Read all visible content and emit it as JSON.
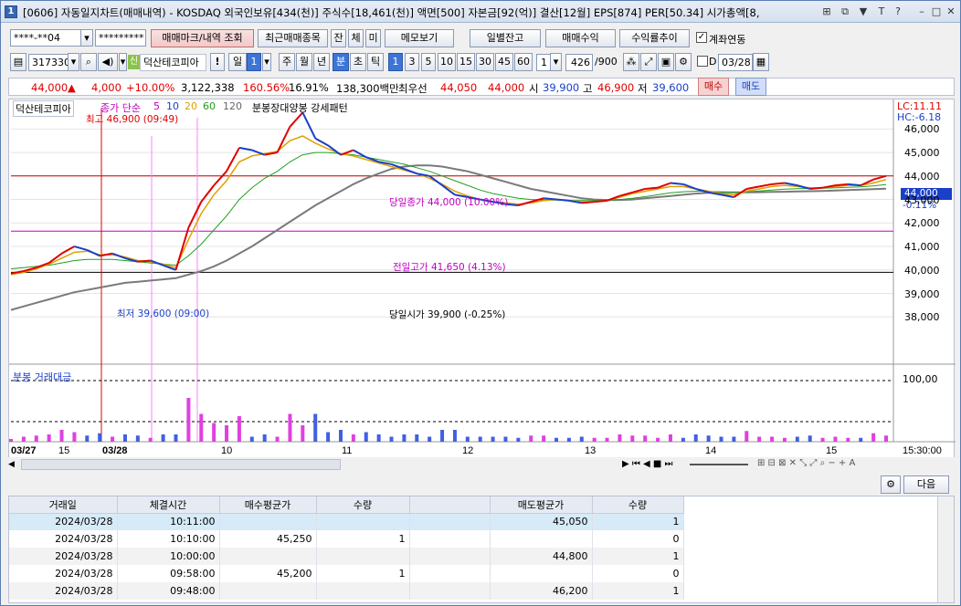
{
  "title": "[0606] 자동일지차트(매매내역) - KOSDAQ 외국인보유[434(천)] 주식수[18,461(천)] 액면[500] 자본금[92(억)] 결산[12월] EPS[874] PER[50.34] 시가총액[8,",
  "window_num": "1",
  "toolbar1": {
    "account": "****-**04",
    "password": "*********",
    "trade_mark_btn": "매매마크/내역 조회",
    "recent_trades_btn": "최근매매종목",
    "btn_balance": "잔",
    "btn_exec": "체",
    "btn_unexec": "미",
    "memo_btn": "메모보기",
    "daily_balance_btn": "일별잔고",
    "trade_profit_btn": "매매수익",
    "profit_trend_btn": "수익률추이",
    "account_link_label": "계좌연동"
  },
  "toolbar2": {
    "code": "317330",
    "credit_badge": "신",
    "stock_name": "덕산테코피아",
    "alert": "!",
    "period_day": "일",
    "period_day_n": "1",
    "week": "주",
    "month": "월",
    "year": "년",
    "minute": "분",
    "second": "초",
    "tick": "틱",
    "intervals": [
      "1",
      "3",
      "5",
      "10",
      "15",
      "30",
      "45",
      "60"
    ],
    "interval_select": "1",
    "count": "426",
    "count_max": "/900",
    "date_checkbox": "D",
    "date": "03/28"
  },
  "quote": {
    "price": "44,000",
    "change": "4,000",
    "change_pct": "+10.00%",
    "volume": "3,122,338",
    "vol_ratio": "160.56%",
    "turnover": "16.91%",
    "amount": "138,300백만",
    "best_label": "최우선",
    "best_ask": "44,050",
    "best_bid": "44,000",
    "open_label": "시",
    "open": "39,900",
    "high_label": "고",
    "high": "46,900",
    "low_label": "저",
    "low": "39,600",
    "buy_btn": "매수",
    "sell_btn": "매도"
  },
  "chart_data": {
    "type": "line",
    "title": "덕산테코피아",
    "legend": {
      "ma_label": "종가 단순",
      "ma_periods": [
        "5",
        "10",
        "20",
        "60",
        "120"
      ],
      "pattern": "분봉장대양봉 강세패턴",
      "lc": "LC:11.11",
      "hc": "HC:-6.18"
    },
    "annotations": {
      "high": "최고 46,900 (09:49)",
      "low": "최저 39,600 (09:00)",
      "close_line": "당일종가 44,000 (10.00%)",
      "prev_high_line": "전일고가 41,650 (4.13%)",
      "open_line": "당일시가 39,900 (-0.25%)",
      "price_box": "44,000",
      "price_box_pct": "-0.11%"
    },
    "y_ticks": [
      "46,000",
      "45,000",
      "44,000",
      "43,000",
      "42,000",
      "41,000",
      "40,000",
      "39,000",
      "38,000"
    ],
    "ylim": [
      37700,
      47100
    ],
    "x_ticks": [
      "03/27",
      "15",
      "03/28",
      "10",
      "11",
      "12",
      "13",
      "14",
      "15",
      "15:30:00"
    ],
    "volume_label": "분봉 거래대금",
    "volume_axis": "100,00",
    "close_series": [
      39850,
      39950,
      40100,
      40300,
      40700,
      41000,
      40850,
      40600,
      40700,
      40500,
      40350,
      40400,
      40200,
      40000,
      41800,
      42900,
      43600,
      44200,
      45200,
      45100,
      44900,
      45000,
      46100,
      46700,
      45600,
      45300,
      44900,
      45100,
      44800,
      44600,
      44500,
      44300,
      44100,
      44000,
      43600,
      43200,
      43100,
      43000,
      42900,
      42800,
      42750,
      42900,
      43050,
      43000,
      42950,
      42850,
      42900,
      42950,
      43150,
      43300,
      43450,
      43500,
      43700,
      43650,
      43450,
      43300,
      43200,
      43100,
      43450,
      43550,
      43650,
      43700,
      43600,
      43450,
      43500,
      43600,
      43650,
      43600,
      43850,
      44000
    ],
    "ma_fast": [
      39800,
      39900,
      40050,
      40250,
      40500,
      40750,
      40800,
      40650,
      40650,
      40550,
      40400,
      40350,
      40250,
      40100,
      41300,
      42400,
      43200,
      43800,
      44600,
      44850,
      44950,
      45050,
      45500,
      45700,
      45400,
      45150,
      44950,
      44850,
      44700,
      44550,
      44400,
      44250,
      44100,
      43900,
      43650,
      43350,
      43150,
      43000,
      42900,
      42850,
      42800,
      42850,
      42950,
      43000,
      42950,
      42900,
      42900,
      42950,
      43100,
      43250,
      43350,
      43450,
      43550,
      43550,
      43450,
      43350,
      43250,
      43200,
      43350,
      43450,
      43550,
      43600,
      43550,
      43500,
      43500,
      43550,
      43600,
      43600,
      43700,
      43850
    ],
    "ma_mid": [
      40050,
      40100,
      40150,
      40200,
      40300,
      40400,
      40450,
      40450,
      40450,
      40400,
      40350,
      40300,
      40250,
      40200,
      40600,
      41100,
      41700,
      42300,
      43000,
      43500,
      43900,
      44200,
      44600,
      44900,
      45000,
      45000,
      44950,
      44900,
      44800,
      44700,
      44600,
      44500,
      44350,
      44200,
      44000,
      43800,
      43600,
      43400,
      43250,
      43150,
      43050,
      43000,
      42980,
      42970,
      42960,
      42950,
      42950,
      42960,
      43000,
      43050,
      43120,
      43200,
      43280,
      43330,
      43350,
      43340,
      43320,
      43300,
      43320,
      43360,
      43400,
      43440,
      43460,
      43470,
      43480,
      43500,
      43520,
      43540,
      43580,
      43630
    ],
    "ma_slow": [
      38300,
      38450,
      38600,
      38750,
      38900,
      39050,
      39150,
      39250,
      39350,
      39450,
      39500,
      39550,
      39600,
      39650,
      39800,
      39950,
      40150,
      40400,
      40700,
      41000,
      41350,
      41700,
      42050,
      42400,
      42750,
      43050,
      43350,
      43650,
      43900,
      44100,
      44300,
      44400,
      44450,
      44450,
      44400,
      44300,
      44200,
      44050,
      43900,
      43750,
      43600,
      43450,
      43350,
      43250,
      43150,
      43050,
      43000,
      42980,
      42980,
      43000,
      43050,
      43100,
      43150,
      43200,
      43250,
      43280,
      43300,
      43300,
      43300,
      43310,
      43320,
      43330,
      43340,
      43350,
      43360,
      43380,
      43400,
      43420,
      43440,
      43460
    ]
  },
  "table": {
    "columns": [
      "거래일",
      "체결시간",
      "매수평균가",
      "수량",
      "",
      "매도평균가",
      "수량"
    ],
    "rows": [
      [
        "2024/03/28",
        "10:11:00",
        "",
        "",
        "",
        "45,050",
        "1"
      ],
      [
        "2024/03/28",
        "10:10:00",
        "45,250",
        "1",
        "",
        "",
        "0"
      ],
      [
        "2024/03/28",
        "10:00:00",
        "",
        "",
        "",
        "44,800",
        "1"
      ],
      [
        "2024/03/28",
        "09:58:00",
        "45,200",
        "1",
        "",
        "",
        "0"
      ],
      [
        "2024/03/28",
        "09:48:00",
        "",
        "",
        "",
        "46,200",
        "1"
      ]
    ],
    "next_btn": "다음"
  }
}
